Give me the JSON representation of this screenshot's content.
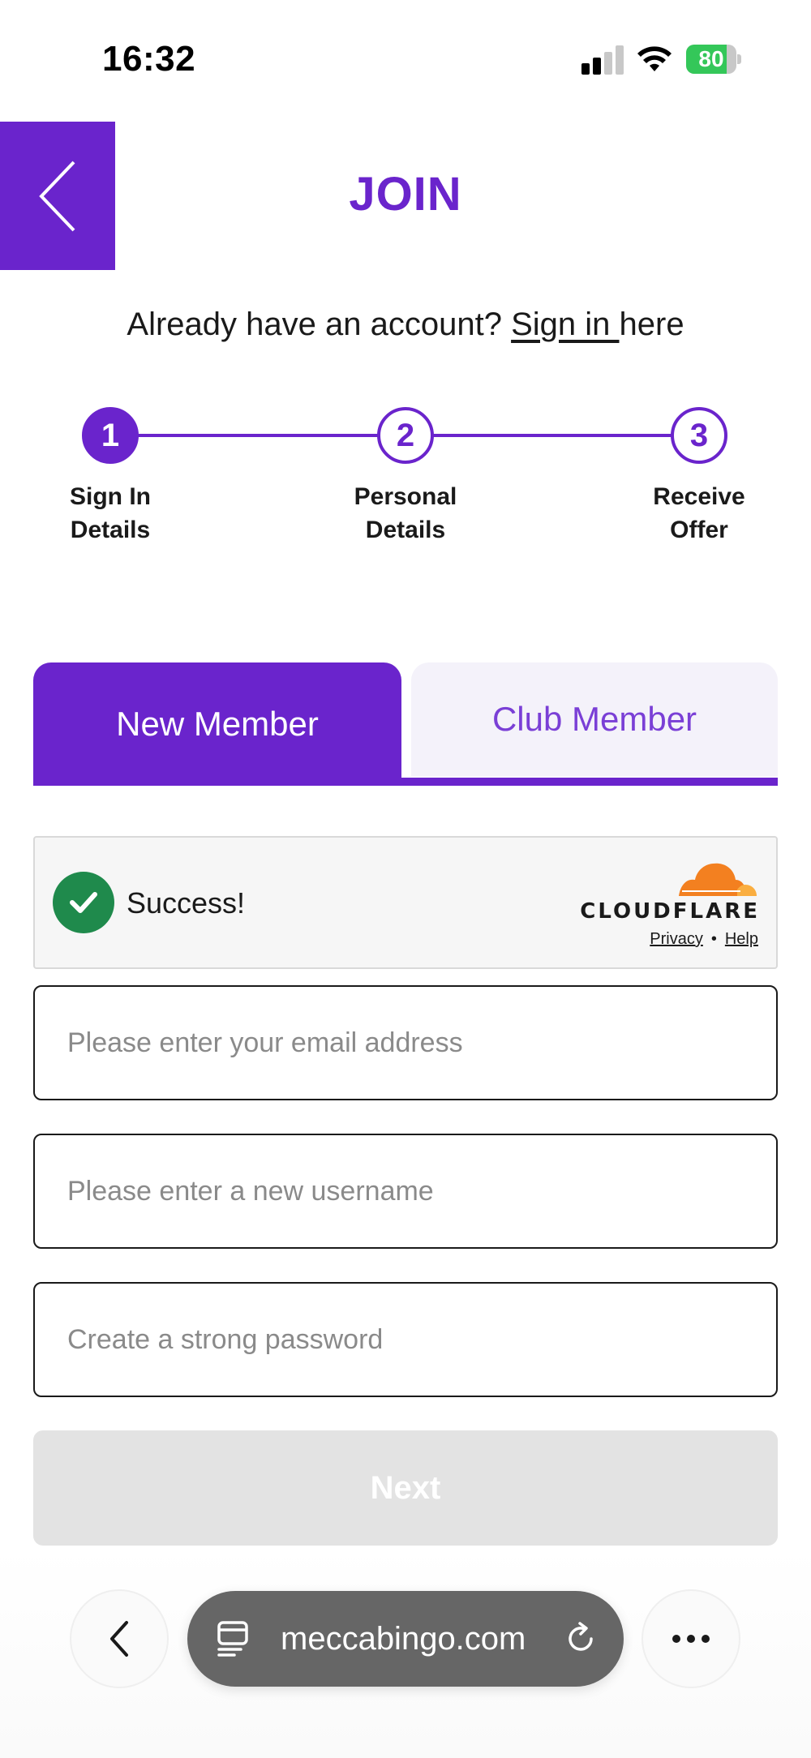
{
  "status_bar": {
    "time": "16:32",
    "battery_level": "80",
    "battery_charging": true,
    "signal_bars": 2,
    "icons": [
      "signal-icon",
      "wifi-icon",
      "battery-icon"
    ]
  },
  "header": {
    "back_icon": "chevron-left-icon",
    "title": "JOIN"
  },
  "signin_prompt": {
    "prefix": "Already have an account? ",
    "link": "Sign in ",
    "suffix": "here"
  },
  "stepper": {
    "active_step": 1,
    "steps": [
      {
        "number": "1",
        "line1": "Sign In",
        "line2": "Details"
      },
      {
        "number": "2",
        "line1": "Personal",
        "line2": "Details"
      },
      {
        "number": "3",
        "line1": "Receive",
        "line2": "Offer"
      }
    ]
  },
  "tabs": {
    "new_member": "New Member",
    "club_member": "Club Member",
    "selected": "new_member"
  },
  "captcha": {
    "status": "Success!",
    "brand": "CLOUDFLARE",
    "privacy": "Privacy",
    "separator": "•",
    "help": "Help"
  },
  "form": {
    "email_placeholder": "Please enter your email address",
    "username_placeholder": "Please enter a new username",
    "password_placeholder": "Create a strong password",
    "next_label": "Next"
  },
  "browser": {
    "url": "meccabingo.com",
    "icons": [
      "chevron-left-icon",
      "tabs-icon",
      "reload-icon",
      "more-icon"
    ]
  },
  "colors": {
    "brand_purple": "#6a24cc",
    "success_green": "#1f8a4c",
    "cloudflare_orange": "#f38020",
    "disabled_button": "#e3e3e3",
    "battery_green": "#34c759"
  }
}
